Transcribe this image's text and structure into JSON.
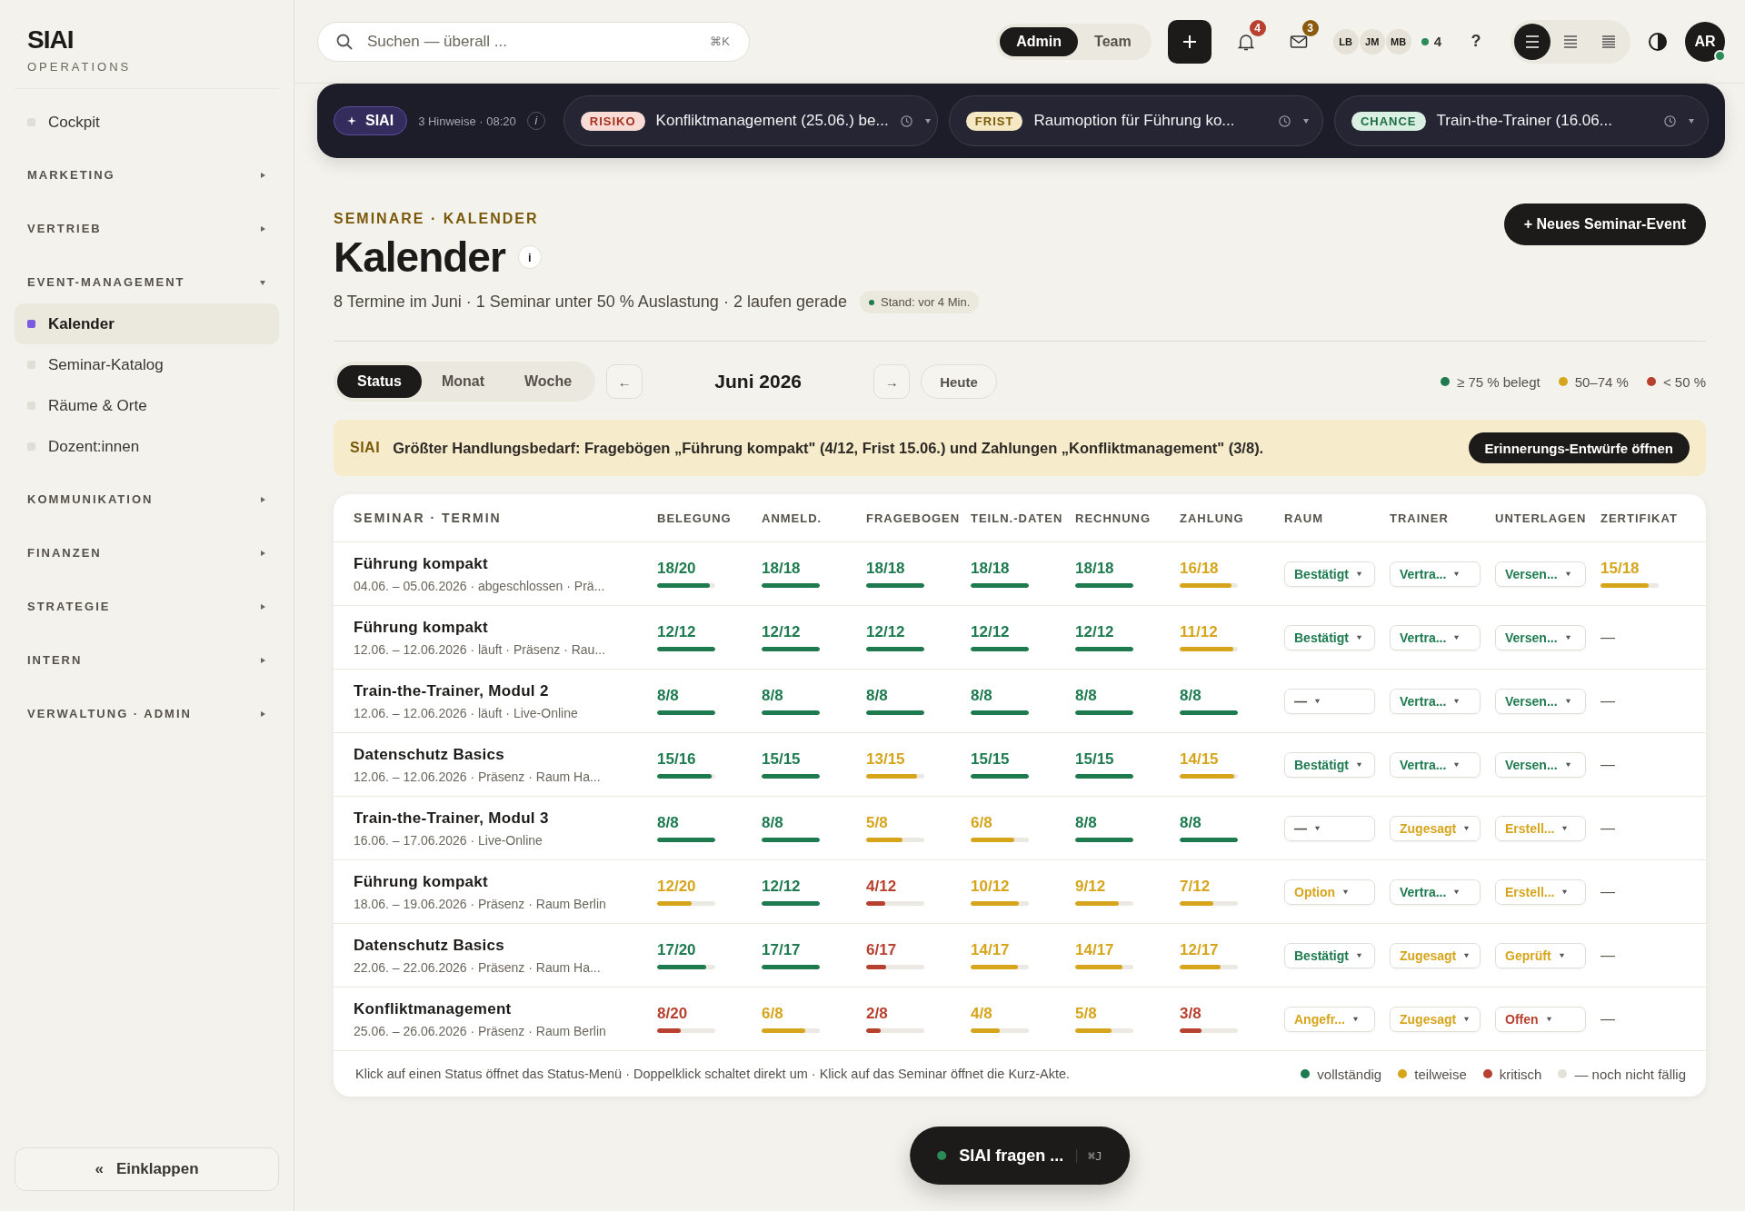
{
  "brand": {
    "name": "SIAI",
    "sub": "OPERATIONS"
  },
  "sidebar": {
    "items": [
      {
        "kind": "link",
        "label": "Cockpit",
        "selected": false
      },
      {
        "kind": "section",
        "label": "MARKETING",
        "expanded": false
      },
      {
        "kind": "section",
        "label": "VERTRIEB",
        "expanded": false
      },
      {
        "kind": "section",
        "label": "EVENT-MANAGEMENT",
        "expanded": true,
        "children": [
          {
            "label": "Kalender",
            "selected": true
          },
          {
            "label": "Seminar-Katalog",
            "selected": false
          },
          {
            "label": "Räume & Orte",
            "selected": false
          },
          {
            "label": "Dozent:innen",
            "selected": false
          }
        ]
      },
      {
        "kind": "section",
        "label": "KOMMUNIKATION",
        "expanded": false
      },
      {
        "kind": "section",
        "label": "FINANZEN",
        "expanded": false
      },
      {
        "kind": "section",
        "label": "STRATEGIE",
        "expanded": false
      },
      {
        "kind": "section",
        "label": "INTERN",
        "expanded": false
      },
      {
        "kind": "section",
        "label": "VERWALTUNG · ADMIN",
        "expanded": false
      }
    ],
    "collapse": {
      "icon": "«",
      "label": "Einklappen"
    }
  },
  "topbar": {
    "search": {
      "placeholder": "Suchen — überall ...",
      "shortcut": "⌘K"
    },
    "roles": [
      {
        "label": "Admin",
        "selected": true
      },
      {
        "label": "Team",
        "selected": false
      }
    ],
    "notifications": "4",
    "messages": "3",
    "users": [
      "LB",
      "JM",
      "MB"
    ],
    "online": "4",
    "help": "?",
    "density": [
      {
        "selected": true
      },
      {
        "selected": false
      },
      {
        "selected": false
      }
    ],
    "avatar": "AR"
  },
  "banner": {
    "label": "SIAI",
    "meta": "3 Hinweise · 08:20",
    "info": "i",
    "hints": [
      {
        "tag": "RISIKO",
        "kind": "risk",
        "text": "Konfliktmanagement (25.06.) be..."
      },
      {
        "tag": "FRIST",
        "kind": "deadline",
        "text": "Raumoption für Führung ko..."
      },
      {
        "tag": "CHANCE",
        "kind": "chance",
        "text": "Train-the-Trainer (16.06..."
      }
    ]
  },
  "header": {
    "breadcrumb": "SEMINARE · KALENDER",
    "title": "Kalender",
    "info": "i",
    "summary": "8 Termine im Juni · 1 Seminar unter 50 % Auslastung · 2 laufen gerade",
    "stand": "Stand: vor 4 Min.",
    "new_button": "+ Neues Seminar-Event"
  },
  "controls": {
    "views": [
      {
        "label": "Status",
        "selected": true
      },
      {
        "label": "Monat",
        "selected": false
      },
      {
        "label": "Woche",
        "selected": false
      }
    ],
    "prev": "←",
    "month": "Juni 2026",
    "next": "→",
    "today": "Heute",
    "legend": [
      {
        "label": "≥ 75 % belegt",
        "color": "#1e7a4f"
      },
      {
        "label": "50–74 %",
        "color": "#d6a51c"
      },
      {
        "label": "< 50 %",
        "color": "#b8402e"
      }
    ]
  },
  "alert": {
    "label": "SIAI",
    "text": "Größter Handlungsbedarf: Fragebögen „Führung kompakt\" (4/12, Frist 15.06.) und Zahlungen „Konfliktmanagement\" (3/8).",
    "button": "Erinnerungs-Entwürfe öffnen"
  },
  "table": {
    "columns": [
      "SEMINAR · TERMIN",
      "BELEGUNG",
      "ANMELD.",
      "FRAGEBOGEN",
      "TEILN.-DATEN",
      "RECHNUNG",
      "ZAHLUNG",
      "RAUM",
      "TRAINER",
      "UNTERLAGEN",
      "ZERTIFIKAT"
    ],
    "rows": [
      {
        "cells": [
          {
            "kind": "seminar",
            "title": "Führung kompakt",
            "sub": "04.06. – 05.06.2026 · abgeschlossen · Prä..."
          },
          {
            "kind": "progress",
            "value": "18/20",
            "level": 0.9,
            "color": "#1e7a4f"
          },
          {
            "kind": "progress",
            "value": "18/18",
            "level": 1,
            "color": "#1e7a4f"
          },
          {
            "kind": "progress",
            "value": "18/18",
            "level": 1,
            "color": "#1e7a4f"
          },
          {
            "kind": "progress",
            "value": "18/18",
            "level": 1,
            "color": "#1e7a4f"
          },
          {
            "kind": "progress",
            "value": "18/18",
            "level": 1,
            "color": "#1e7a4f"
          },
          {
            "kind": "progress",
            "value": "16/18",
            "level": 0.89,
            "color": "#d6a51c"
          },
          {
            "kind": "select",
            "value": "Bestätigt",
            "color": "#1e7a4f"
          },
          {
            "kind": "select",
            "value": "Vertra...",
            "color": "#1e7a4f"
          },
          {
            "kind": "select",
            "value": "Versen...",
            "color": "#1e7a4f"
          },
          {
            "kind": "progress",
            "value": "15/18",
            "level": 0.83,
            "color": "#d6a51c"
          }
        ]
      },
      {
        "cells": [
          {
            "kind": "seminar",
            "title": "Führung kompakt",
            "sub": "12.06. – 12.06.2026 · läuft · Präsenz · Rau..."
          },
          {
            "kind": "progress",
            "value": "12/12",
            "level": 1,
            "color": "#1e7a4f"
          },
          {
            "kind": "progress",
            "value": "12/12",
            "level": 1,
            "color": "#1e7a4f"
          },
          {
            "kind": "progress",
            "value": "12/12",
            "level": 1,
            "color": "#1e7a4f"
          },
          {
            "kind": "progress",
            "value": "12/12",
            "level": 1,
            "color": "#1e7a4f"
          },
          {
            "kind": "progress",
            "value": "12/12",
            "level": 1,
            "color": "#1e7a4f"
          },
          {
            "kind": "progress",
            "value": "11/12",
            "level": 0.92,
            "color": "#d6a51c"
          },
          {
            "kind": "select",
            "value": "Bestätigt",
            "color": "#1e7a4f"
          },
          {
            "kind": "select",
            "value": "Vertra...",
            "color": "#1e7a4f"
          },
          {
            "kind": "select",
            "value": "Versen...",
            "color": "#1e7a4f"
          },
          {
            "kind": "text",
            "value": "—"
          }
        ]
      },
      {
        "cells": [
          {
            "kind": "seminar",
            "title": "Train-the-Trainer, Modul 2",
            "sub": "12.06. – 12.06.2026 · läuft · Live-Online"
          },
          {
            "kind": "progress",
            "value": "8/8",
            "level": 1,
            "color": "#1e7a4f"
          },
          {
            "kind": "progress",
            "value": "8/8",
            "level": 1,
            "color": "#1e7a4f"
          },
          {
            "kind": "progress",
            "value": "8/8",
            "level": 1,
            "color": "#1e7a4f"
          },
          {
            "kind": "progress",
            "value": "8/8",
            "level": 1,
            "color": "#1e7a4f"
          },
          {
            "kind": "progress",
            "value": "8/8",
            "level": 1,
            "color": "#1e7a4f"
          },
          {
            "kind": "progress",
            "value": "8/8",
            "level": 1,
            "color": "#1e7a4f"
          },
          {
            "kind": "select",
            "value": "—",
            "color": "#4a463f"
          },
          {
            "kind": "select",
            "value": "Vertra...",
            "color": "#1e7a4f"
          },
          {
            "kind": "select",
            "value": "Versen...",
            "color": "#1e7a4f"
          },
          {
            "kind": "text",
            "value": "—"
          }
        ]
      },
      {
        "cells": [
          {
            "kind": "seminar",
            "title": "Datenschutz Basics",
            "sub": "12.06. – 12.06.2026 · Präsenz · Raum Ha..."
          },
          {
            "kind": "progress",
            "value": "15/16",
            "level": 0.94,
            "color": "#1e7a4f"
          },
          {
            "kind": "progress",
            "value": "15/15",
            "level": 1,
            "color": "#1e7a4f"
          },
          {
            "kind": "progress",
            "value": "13/15",
            "level": 0.87,
            "color": "#d6a51c"
          },
          {
            "kind": "progress",
            "value": "15/15",
            "level": 1,
            "color": "#1e7a4f"
          },
          {
            "kind": "progress",
            "value": "15/15",
            "level": 1,
            "color": "#1e7a4f"
          },
          {
            "kind": "progress",
            "value": "14/15",
            "level": 0.93,
            "color": "#d6a51c"
          },
          {
            "kind": "select",
            "value": "Bestätigt",
            "color": "#1e7a4f"
          },
          {
            "kind": "select",
            "value": "Vertra...",
            "color": "#1e7a4f"
          },
          {
            "kind": "select",
            "value": "Versen...",
            "color": "#1e7a4f"
          },
          {
            "kind": "text",
            "value": "—"
          }
        ]
      },
      {
        "cells": [
          {
            "kind": "seminar",
            "title": "Train-the-Trainer, Modul 3",
            "sub": "16.06. – 17.06.2026 · Live-Online"
          },
          {
            "kind": "progress",
            "value": "8/8",
            "level": 1,
            "color": "#1e7a4f"
          },
          {
            "kind": "progress",
            "value": "8/8",
            "level": 1,
            "color": "#1e7a4f"
          },
          {
            "kind": "progress",
            "value": "5/8",
            "level": 0.63,
            "color": "#d6a51c"
          },
          {
            "kind": "progress",
            "value": "6/8",
            "level": 0.75,
            "color": "#d6a51c"
          },
          {
            "kind": "progress",
            "value": "8/8",
            "level": 1,
            "color": "#1e7a4f"
          },
          {
            "kind": "progress",
            "value": "8/8",
            "level": 1,
            "color": "#1e7a4f"
          },
          {
            "kind": "select",
            "value": "—",
            "color": "#4a463f"
          },
          {
            "kind": "select",
            "value": "Zugesagt",
            "color": "#d6a51c"
          },
          {
            "kind": "select",
            "value": "Erstell...",
            "color": "#d6a51c"
          },
          {
            "kind": "text",
            "value": "—"
          }
        ]
      },
      {
        "cells": [
          {
            "kind": "seminar",
            "title": "Führung kompakt",
            "sub": "18.06. – 19.06.2026 · Präsenz · Raum Berlin"
          },
          {
            "kind": "progress",
            "value": "12/20",
            "level": 0.6,
            "color": "#d6a51c"
          },
          {
            "kind": "progress",
            "value": "12/12",
            "level": 1,
            "color": "#1e7a4f"
          },
          {
            "kind": "progress",
            "value": "4/12",
            "level": 0.33,
            "color": "#b8402e"
          },
          {
            "kind": "progress",
            "value": "10/12",
            "level": 0.83,
            "color": "#d6a51c"
          },
          {
            "kind": "progress",
            "value": "9/12",
            "level": 0.75,
            "color": "#d6a51c"
          },
          {
            "kind": "progress",
            "value": "7/12",
            "level": 0.58,
            "color": "#d6a51c"
          },
          {
            "kind": "select",
            "value": "Option",
            "color": "#d6a51c"
          },
          {
            "kind": "select",
            "value": "Vertra...",
            "color": "#1e7a4f"
          },
          {
            "kind": "select",
            "value": "Erstell...",
            "color": "#d6a51c"
          },
          {
            "kind": "text",
            "value": "—"
          }
        ]
      },
      {
        "cells": [
          {
            "kind": "seminar",
            "title": "Datenschutz Basics",
            "sub": "22.06. – 22.06.2026 · Präsenz · Raum Ha..."
          },
          {
            "kind": "progress",
            "value": "17/20",
            "level": 0.85,
            "color": "#1e7a4f"
          },
          {
            "kind": "progress",
            "value": "17/17",
            "level": 1,
            "color": "#1e7a4f"
          },
          {
            "kind": "progress",
            "value": "6/17",
            "level": 0.35,
            "color": "#b8402e"
          },
          {
            "kind": "progress",
            "value": "14/17",
            "level": 0.82,
            "color": "#d6a51c"
          },
          {
            "kind": "progress",
            "value": "14/17",
            "level": 0.82,
            "color": "#d6a51c"
          },
          {
            "kind": "progress",
            "value": "12/17",
            "level": 0.71,
            "color": "#d6a51c"
          },
          {
            "kind": "select",
            "value": "Bestätigt",
            "color": "#1e7a4f"
          },
          {
            "kind": "select",
            "value": "Zugesagt",
            "color": "#d6a51c"
          },
          {
            "kind": "select",
            "value": "Geprüft",
            "color": "#d6a51c"
          },
          {
            "kind": "text",
            "value": "—"
          }
        ]
      },
      {
        "cells": [
          {
            "kind": "seminar",
            "title": "Konfliktmanagement",
            "sub": "25.06. – 26.06.2026 · Präsenz · Raum Berlin"
          },
          {
            "kind": "progress",
            "value": "8/20",
            "level": 0.4,
            "color": "#b8402e"
          },
          {
            "kind": "progress",
            "value": "6/8",
            "level": 0.75,
            "color": "#d6a51c"
          },
          {
            "kind": "progress",
            "value": "2/8",
            "level": 0.25,
            "color": "#b8402e"
          },
          {
            "kind": "progress",
            "value": "4/8",
            "level": 0.5,
            "color": "#d6a51c"
          },
          {
            "kind": "progress",
            "value": "5/8",
            "level": 0.63,
            "color": "#d6a51c"
          },
          {
            "kind": "progress",
            "value": "3/8",
            "level": 0.38,
            "color": "#b8402e"
          },
          {
            "kind": "select",
            "value": "Angefr...",
            "color": "#d6a51c"
          },
          {
            "kind": "select",
            "value": "Zugesagt",
            "color": "#d6a51c"
          },
          {
            "kind": "select",
            "value": "Offen",
            "color": "#b8402e"
          },
          {
            "kind": "text",
            "value": "—"
          }
        ]
      }
    ],
    "note": "Klick auf einen Status öffnet das Status-Menü · Doppelklick schaltet direkt um · Klick auf das Seminar öffnet die Kurz-Akte.",
    "legend": [
      {
        "label": "vollständig",
        "color": "#1e7a4f"
      },
      {
        "label": "teilweise",
        "color": "#d6a51c"
      },
      {
        "label": "kritisch",
        "color": "#b8402e"
      },
      {
        "label": "— noch nicht fällig",
        "color": "#e4e1d8"
      }
    ]
  },
  "assistant": {
    "label": "SIAI fragen ...",
    "shortcut": "⌘J"
  }
}
